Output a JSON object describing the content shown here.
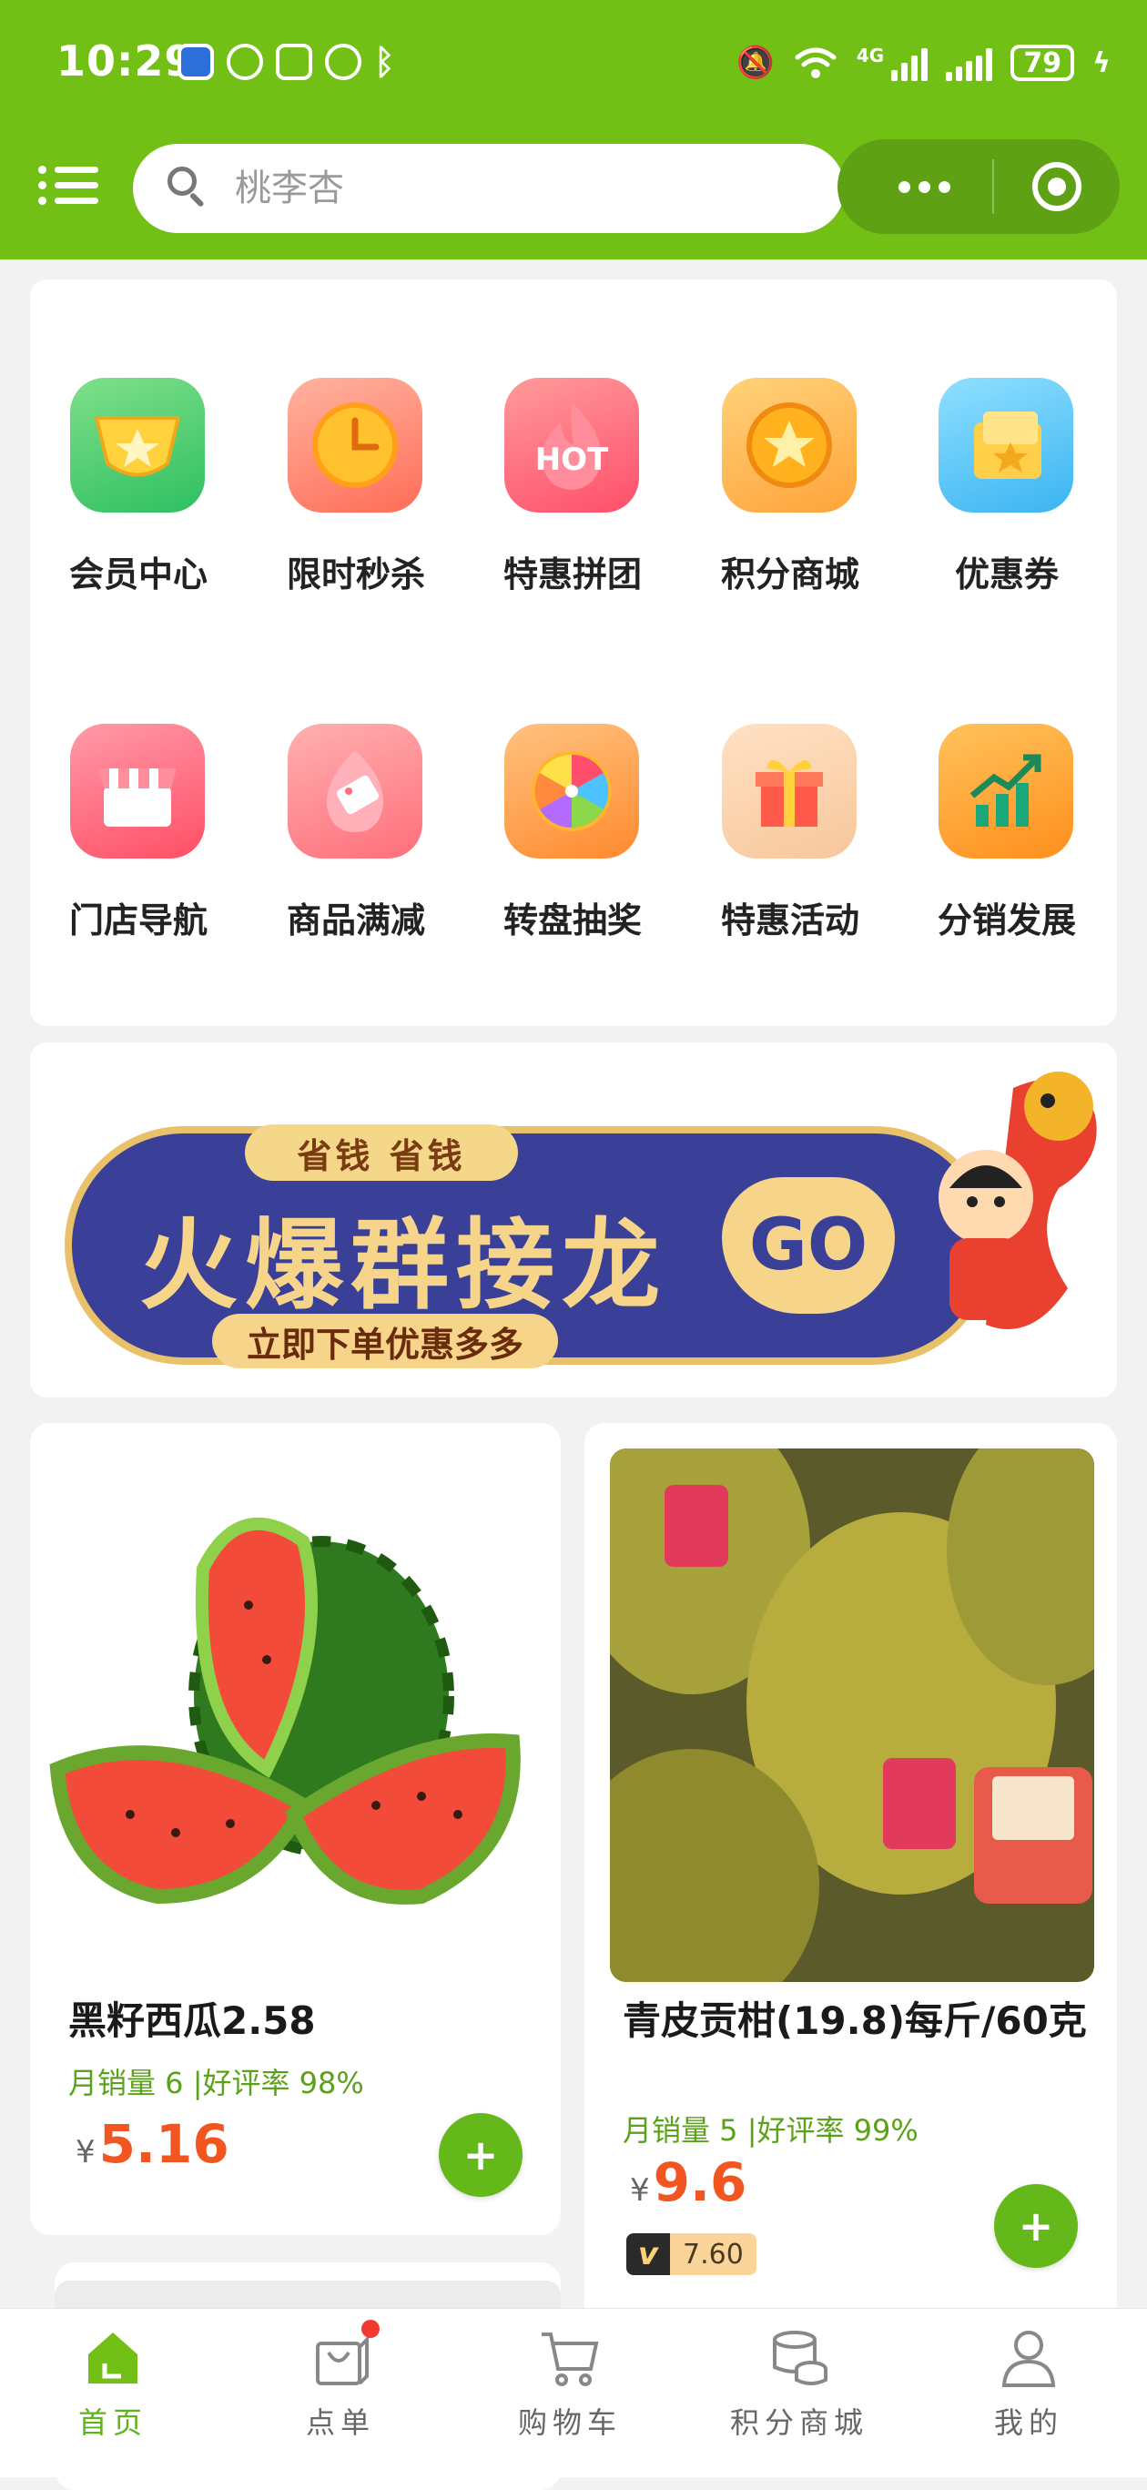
{
  "status_bar": {
    "time": "10:29",
    "network": "4G",
    "battery": "79"
  },
  "search": {
    "placeholder": "桃李杏"
  },
  "quick_menu": [
    {
      "label": "会员中心",
      "icon": "member-cup-icon"
    },
    {
      "label": "限时秒杀",
      "icon": "clock-icon"
    },
    {
      "label": "特惠拼团",
      "icon": "hot-flame-icon"
    },
    {
      "label": "积分商城",
      "icon": "coin-icon"
    },
    {
      "label": "优惠券",
      "icon": "coupon-icon"
    },
    {
      "label": "门店导航",
      "icon": "store-icon"
    },
    {
      "label": "商品满减",
      "icon": "price-tag-icon"
    },
    {
      "label": "转盘抽奖",
      "icon": "prize-wheel-icon"
    },
    {
      "label": "特惠活动",
      "icon": "gift-box-icon"
    },
    {
      "label": "分销发展",
      "icon": "growth-chart-icon"
    }
  ],
  "banner": {
    "tag": "省钱 省钱",
    "title": "火爆群接龙",
    "button": "GO",
    "subtitle": "立即下单优惠多多"
  },
  "products": [
    {
      "name": "黑籽西瓜2.58",
      "stats": "月销量 6 |好评率 98%",
      "currency": "¥",
      "price": "5.16"
    },
    {
      "name": "青皮贡柑(19.8)每斤/60克",
      "stats": "月销量 5 |好评率 99%",
      "currency": "¥",
      "price": "9.6",
      "vip_price": "7.60",
      "vip_label": "v"
    }
  ],
  "tab_bar": [
    {
      "label": "首页",
      "icon": "home-icon",
      "active": true
    },
    {
      "label": "点单",
      "icon": "shopping-bag-icon",
      "active": false
    },
    {
      "label": "购物车",
      "icon": "cart-icon",
      "active": false
    },
    {
      "label": "积分商城",
      "icon": "points-coins-icon",
      "active": false
    },
    {
      "label": "我的",
      "icon": "user-icon",
      "active": false
    }
  ],
  "colors": {
    "brand_green": "#72c015",
    "price_orange": "#f25620",
    "stats_green": "#5ba21a"
  }
}
